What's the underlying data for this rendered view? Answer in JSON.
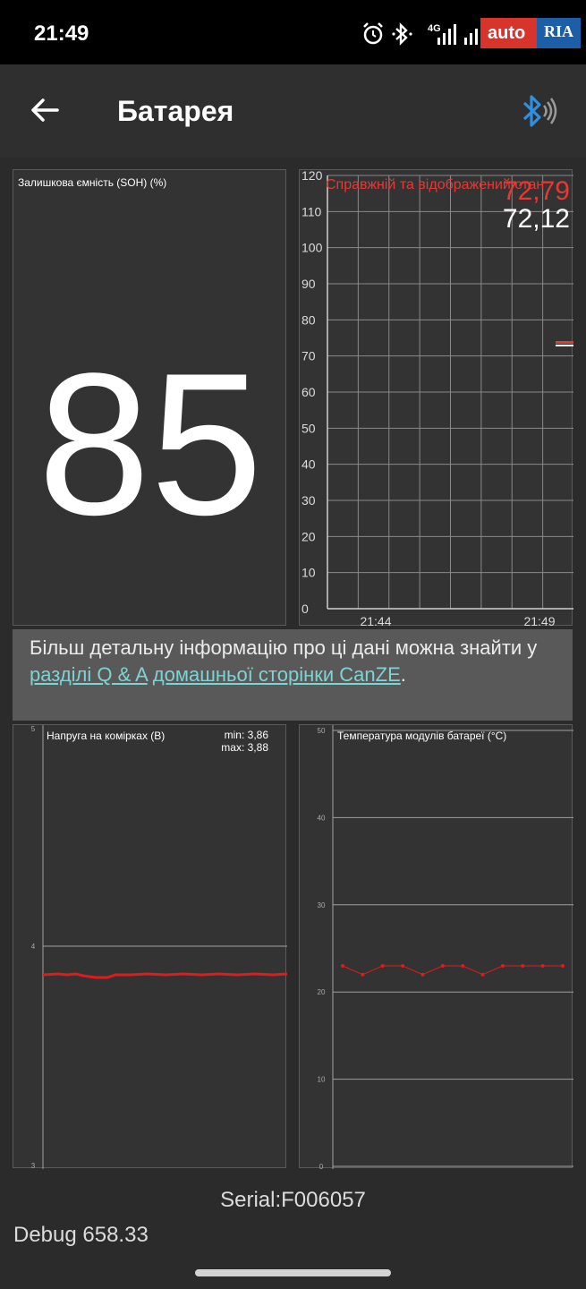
{
  "status_bar": {
    "time": "21:49",
    "network": "4G",
    "icons": [
      "alarm-icon",
      "bluetooth-icon",
      "signal-icon",
      "signal-icon"
    ],
    "watermark_auto": "auto",
    "watermark_ria": "RIA"
  },
  "app_bar": {
    "title": "Батарея",
    "back_icon": "arrow-left-icon",
    "bluetooth_icon": "bluetooth-connected-icon",
    "bluetooth_color": "#2f8fe0"
  },
  "soh": {
    "label": "Залишкова ємність (SOH) (%)",
    "value": "85"
  },
  "soc_chart": {
    "legend": "Справжній та відображений стан",
    "value_real": "72,79",
    "value_displayed": "72,12",
    "y_ticks": [
      "120",
      "110",
      "100",
      "90",
      "80",
      "70",
      "60",
      "50",
      "40",
      "30",
      "20",
      "10",
      "0"
    ],
    "x_ticks": [
      "21:44",
      "21:49"
    ],
    "color_real": "#e53935",
    "color_displayed": "#ffffff"
  },
  "info": {
    "text_before": "Більш детальну інформацію про ці дані можна знайти у ",
    "link1": "разділі Q & A",
    "text_between": " ",
    "link2": "домашньої сторінки CanZE",
    "text_after": "."
  },
  "cell_chart": {
    "title": "Напруга на комірках (В)",
    "min": "min: 3,86",
    "max": "max: 3,88",
    "y_ticks": [
      "5",
      "4",
      "3"
    ],
    "line_color": "#e01b1b"
  },
  "temp_chart": {
    "title": "Температура модулів батареї (°C)",
    "y_ticks": [
      "50",
      "40",
      "30",
      "20",
      "10",
      "0"
    ],
    "values": [
      23,
      22,
      23,
      23,
      22,
      23,
      23,
      22,
      23,
      23,
      23,
      23
    ],
    "line_color": "#e01b1b"
  },
  "footer": {
    "serial": "Serial:F006057",
    "debug": "Debug 658.33"
  }
}
